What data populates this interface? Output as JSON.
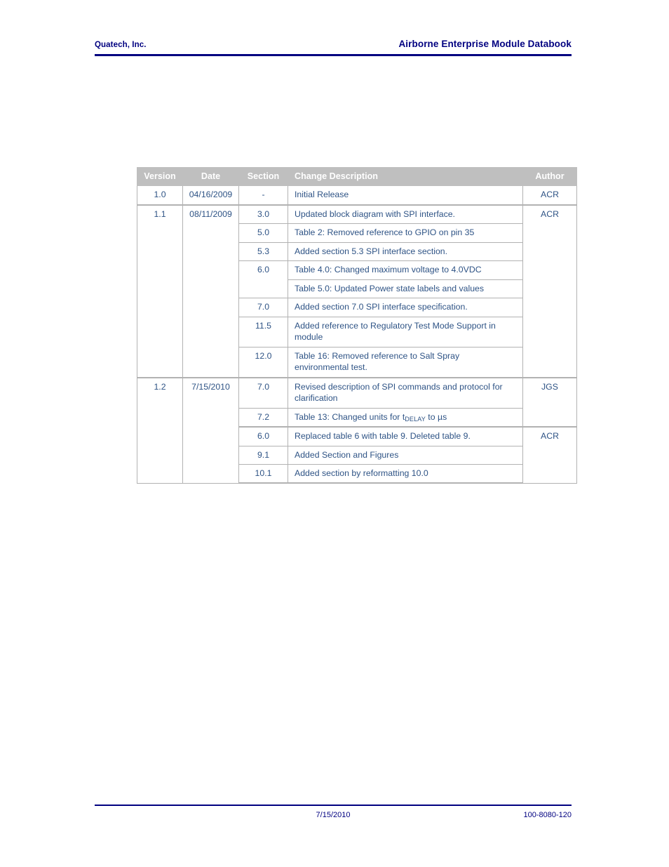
{
  "header": {
    "left": "Quatech, Inc.",
    "right": "Airborne Enterprise Module Databook",
    "rule_color": "#000080"
  },
  "revision_table": {
    "columns": [
      "Version",
      "Date",
      "Section",
      "Change Description",
      "Author"
    ],
    "header_bg": "#bfbfbf",
    "header_text_color": "#ffffff",
    "body_text_color": "#2e5385",
    "border_color": "#b2b2b2",
    "rows": [
      {
        "version": "1.0",
        "date": "04/16/2009",
        "author": "ACR",
        "entries": [
          {
            "section": "-",
            "description": "Initial Release"
          }
        ]
      },
      {
        "version": "1.1",
        "date": "08/11/2009",
        "author": "ACR",
        "entries": [
          {
            "section": "3.0",
            "description": "Updated block diagram with SPI interface."
          },
          {
            "section": "5.0",
            "description": "Table 2: Removed reference to GPIO on pin 35"
          },
          {
            "section": "5.3",
            "description": "Added section 5.3 SPI interface section."
          },
          {
            "section": "6.0",
            "description": "Table 4.0: Changed maximum voltage to 4.0VDC"
          },
          {
            "section": "",
            "description": "Table 5.0: Updated Power state labels and values"
          },
          {
            "section": "7.0",
            "description": "Added section 7.0 SPI interface specification."
          },
          {
            "section": "11.5",
            "description": "Added reference to Regulatory Test Mode Support in module"
          },
          {
            "section": "12.0",
            "description": "Table 16: Removed reference to Salt Spray environmental test."
          }
        ]
      },
      {
        "version": "1.2",
        "date": "7/15/2010",
        "authors": [
          "JGS",
          "ACR"
        ],
        "entries": [
          {
            "section": "7.0",
            "description": "Revised description of SPI commands and protocol for clarification",
            "author": "JGS"
          },
          {
            "section": "7.2",
            "description_prefix": "Table 13: Changed units for t",
            "description_sub": "DELAY",
            "description_suffix": " to µs",
            "author": "JGS"
          },
          {
            "section": "6.0",
            "description": "Replaced table 6 with table 9. Deleted table 9.",
            "author": "ACR"
          },
          {
            "section": "9.1",
            "description": "Added Section and Figures",
            "author": "ACR"
          },
          {
            "section": "10.1",
            "description": "Added section by reformatting 10.0",
            "author": "ACR"
          }
        ]
      }
    ]
  },
  "footer": {
    "date": "7/15/2010",
    "doc_number": "100-8080-120",
    "rule_color": "#000080"
  }
}
